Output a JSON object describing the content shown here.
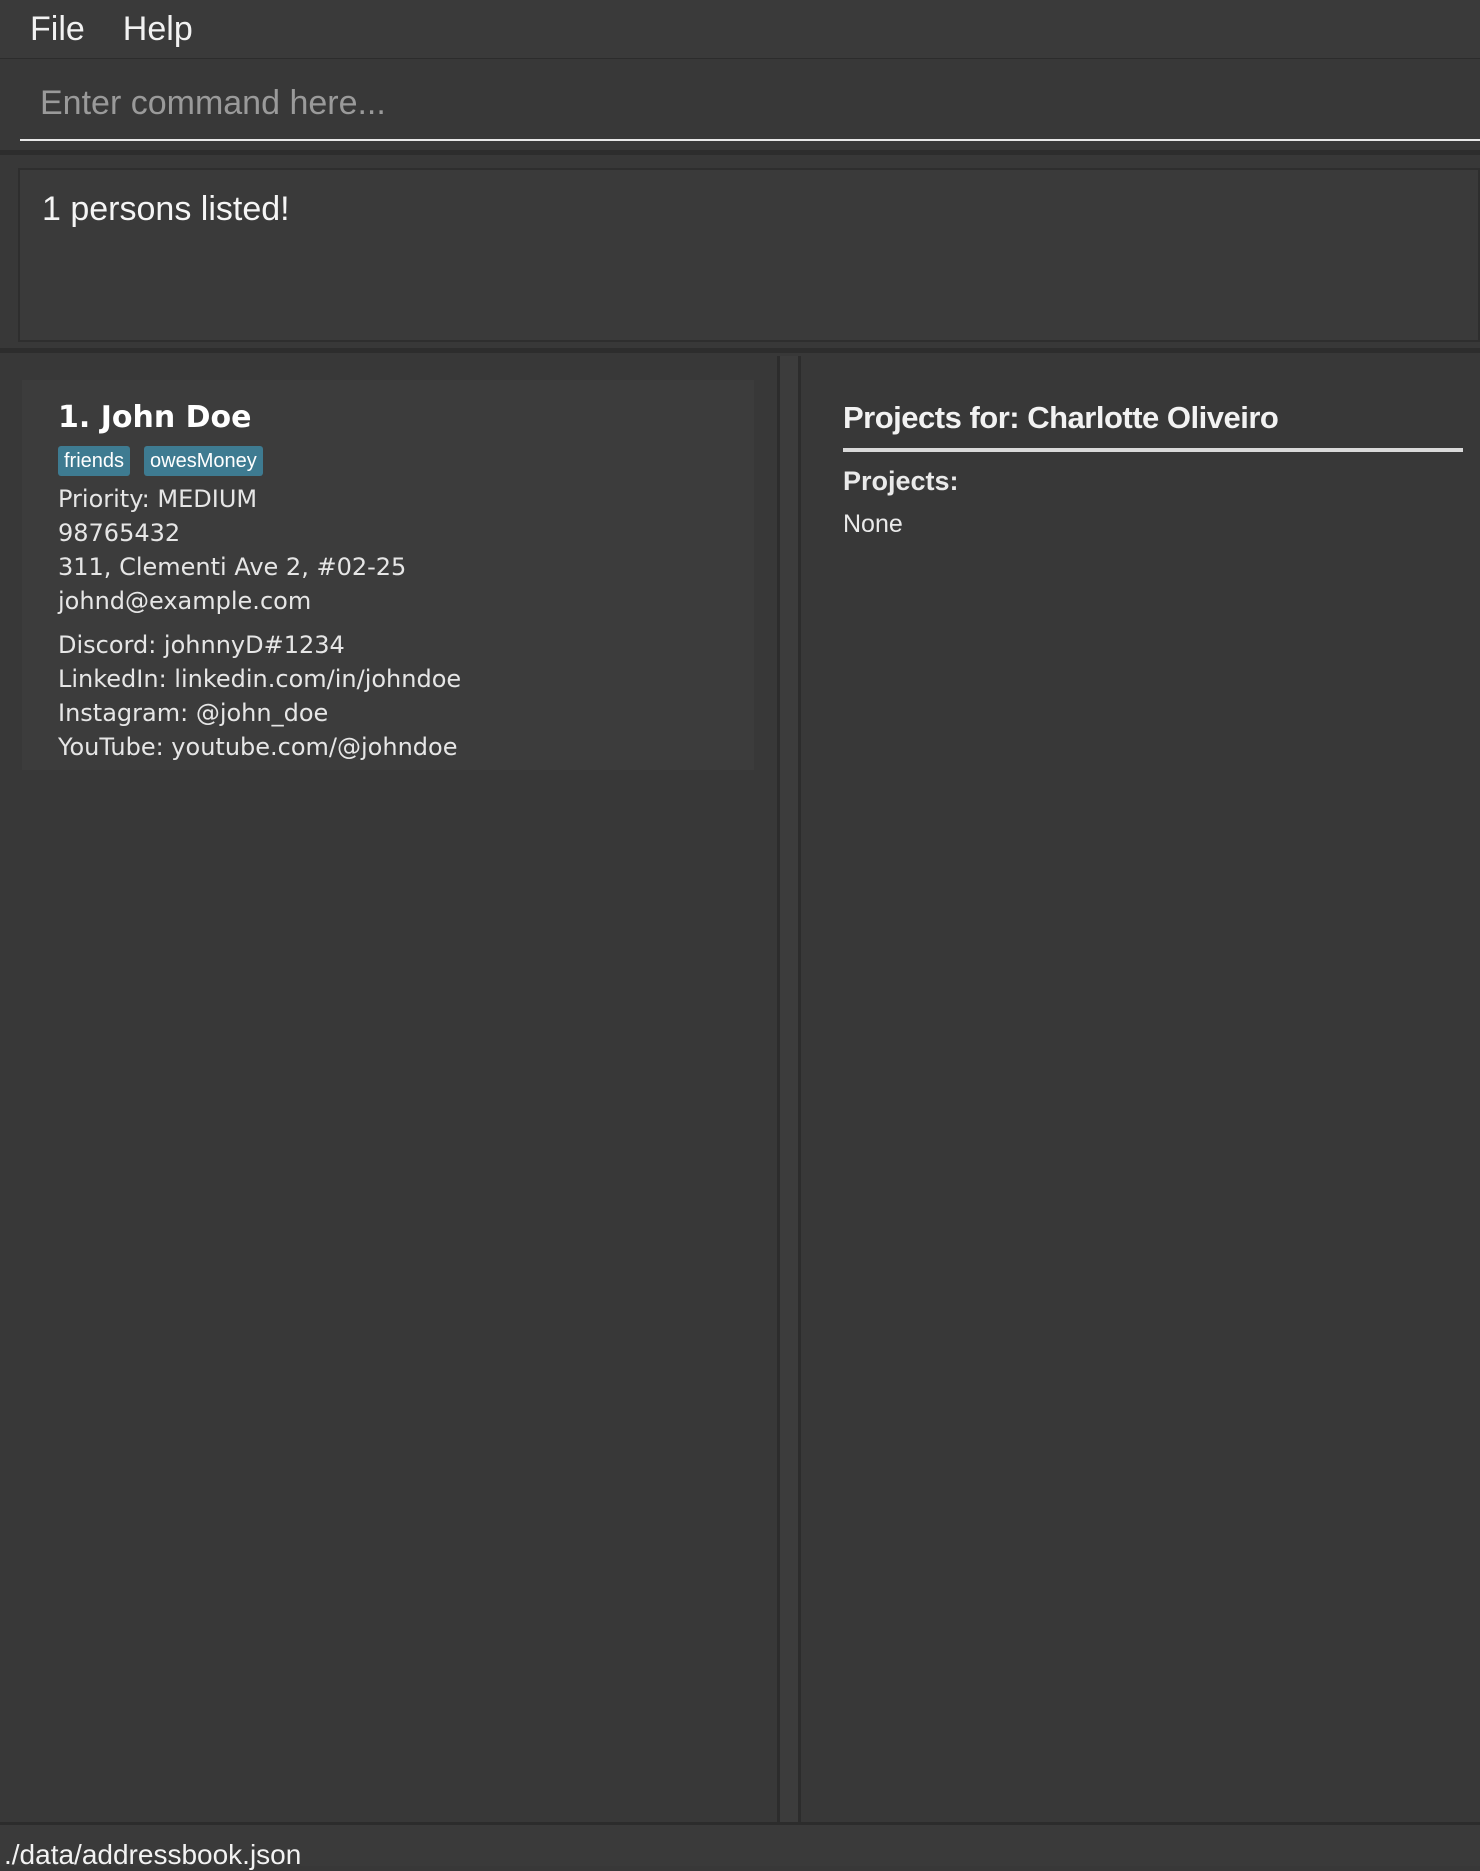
{
  "menu": {
    "items": [
      "File",
      "Help"
    ]
  },
  "command": {
    "placeholder": "Enter command here...",
    "value": ""
  },
  "result": {
    "message": "1 persons listed!"
  },
  "persons": [
    {
      "name": "1. John Doe",
      "tags": [
        "friends",
        "owesMoney"
      ],
      "priority": "Priority: MEDIUM",
      "phone": "98765432",
      "address": "311, Clementi Ave 2, #02-25",
      "email": "johnd@example.com",
      "discord": "Discord: johnnyD#1234",
      "linkedin": "LinkedIn: linkedin.com/in/johndoe",
      "instagram": "Instagram: @john_doe",
      "youtube": "YouTube: youtube.com/@johndoe"
    }
  ],
  "projects": {
    "title": "Projects for: Charlotte Oliveiro",
    "heading": "Projects:",
    "value": "None"
  },
  "status": {
    "path": "./data/addressbook.json"
  },
  "colors": {
    "background": "#383838",
    "tag": "#3e7b91"
  }
}
